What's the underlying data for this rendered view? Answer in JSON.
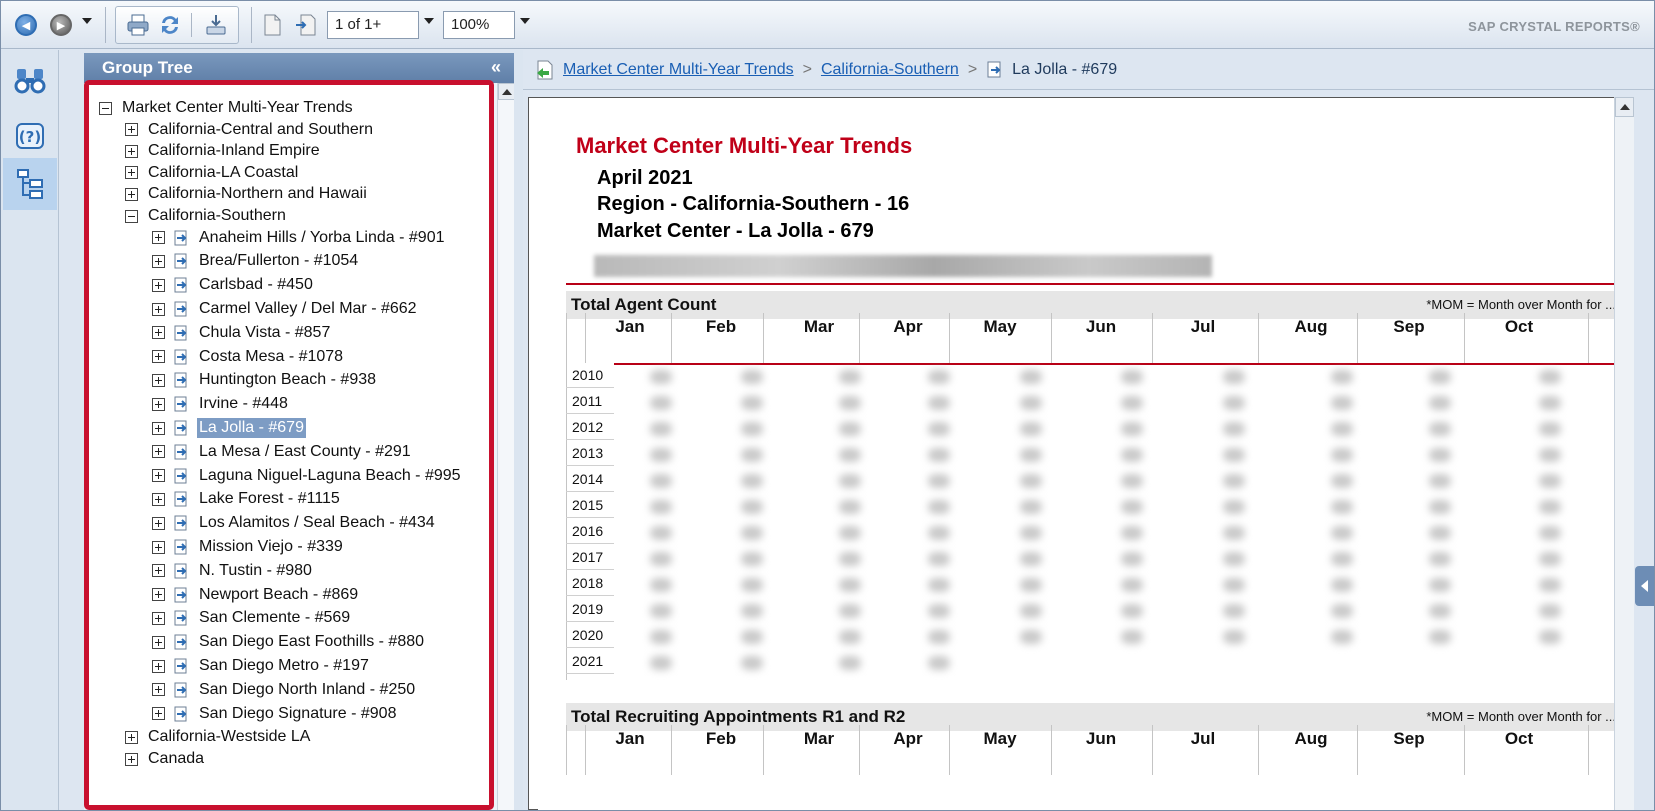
{
  "toolbar": {
    "page_value": "1 of 1+",
    "zoom_value": "100%",
    "brand": "SAP CRYSTAL REPORTS®"
  },
  "group_tree": {
    "title": "Group Tree",
    "collapse_glyph": "«",
    "root": "Market Center Multi-Year Trends",
    "regions_before": [
      "California-Central and Southern",
      "California-Inland Empire",
      "California-LA Coastal",
      "California-Northern and Hawaii"
    ],
    "expanded_region": "California-Southern",
    "market_centers": [
      "Anaheim Hills / Yorba Linda - #901",
      "Brea/Fullerton - #1054",
      "Carlsbad - #450",
      "Carmel Valley / Del Mar - #662",
      "Chula Vista - #857",
      "Costa Mesa - #1078",
      "Huntington Beach - #938",
      "Irvine - #448",
      "La Jolla - #679",
      "La Mesa / East County - #291",
      "Laguna Niguel-Laguna Beach - #995",
      "Lake Forest - #1115",
      "Los Alamitos / Seal Beach - #434",
      "Mission Viejo - #339",
      "N. Tustin - #980",
      "Newport Beach - #869",
      "San Clemente - #569",
      "San Diego East Foothills - #880",
      "San Diego Metro - #197",
      "San Diego North Inland - #250",
      "San Diego Signature - #908"
    ],
    "selected_index": 8,
    "regions_after": [
      "California-Westside LA",
      "Canada"
    ]
  },
  "breadcrumb": {
    "items": [
      "Market Center Multi-Year Trends",
      "California-Southern"
    ],
    "separator": ">",
    "current": "La Jolla - #679"
  },
  "report": {
    "title": "Market Center Multi-Year Trends",
    "date": "April 2021",
    "region": "Region - California-Southern - 16",
    "market_center": "Market Center - La Jolla -  679",
    "sections": [
      {
        "title": "Total Agent Count",
        "note": "*MOM = Month over Month for ..."
      },
      {
        "title": "Total Recruiting Appointments R1 and R2",
        "note": "*MOM = Month over Month for ..."
      }
    ],
    "months": [
      "Jan",
      "Feb",
      "Mar",
      "Apr",
      "May",
      "Jun",
      "Jul",
      "Aug",
      "Sep",
      "Oct"
    ],
    "years": [
      "2010",
      "2011",
      "2012",
      "2013",
      "2014",
      "2015",
      "2016",
      "2017",
      "2018",
      "2019",
      "2020",
      "2021"
    ]
  },
  "colors": {
    "title_red": "#c00018",
    "highlight_border": "#c8102e",
    "tree_header": "#6b8ab3",
    "selected_node": "#7d9cc4",
    "link_blue": "#1a5fb4"
  },
  "icons": {
    "back": "back-icon",
    "forward": "forward-icon",
    "print": "print-icon",
    "refresh": "refresh-icon",
    "export": "export-icon",
    "first_page": "first-page-icon",
    "goto_page": "goto-page-icon",
    "search": "binoculars-icon",
    "help": "help-icon",
    "group_tree": "group-tree-icon",
    "report_node": "report-node-icon"
  }
}
